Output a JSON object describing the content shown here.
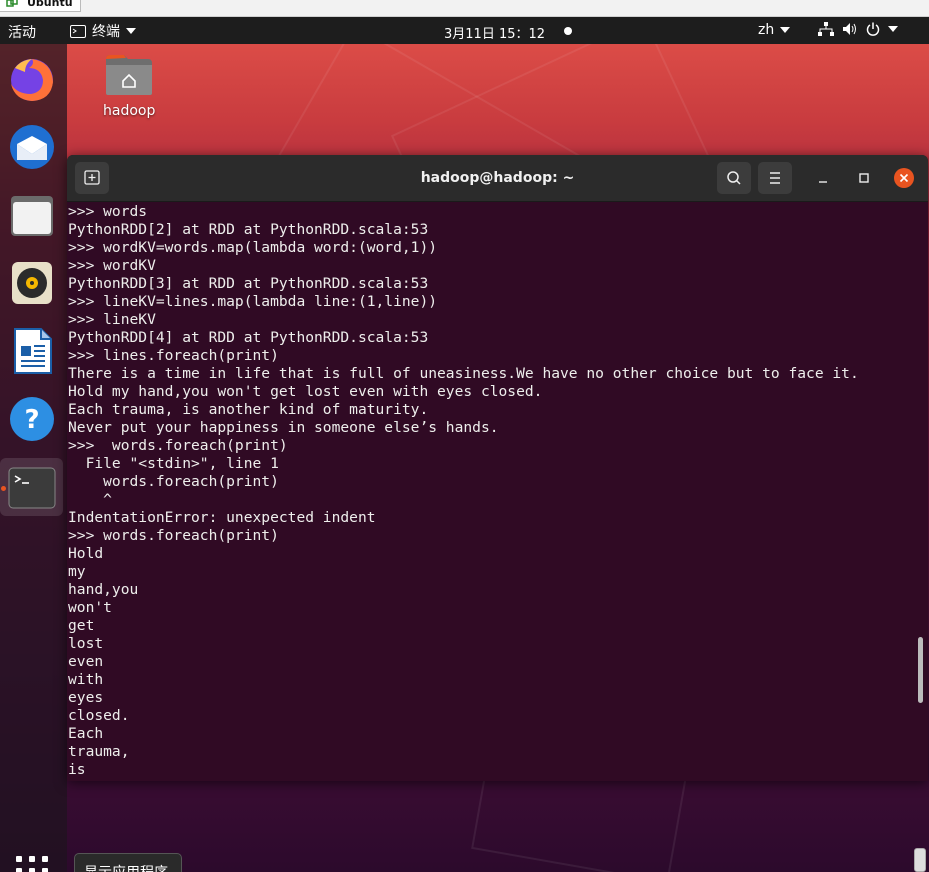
{
  "vm_tab": {
    "label": "Ubuntu"
  },
  "topbar": {
    "activities": "活动",
    "app_menu": "终端",
    "clock": "3月11日 15：12",
    "language": "zh"
  },
  "desktop": {
    "folder_label": "hadoop"
  },
  "dock": {
    "items": [
      "firefox",
      "thunderbird",
      "files",
      "rhythmbox",
      "libreoffice-writer",
      "help",
      "terminal"
    ],
    "show_apps_tooltip": "显示应用程序"
  },
  "terminal": {
    "title": "hadoop@hadoop: ~",
    "lines": [
      ">>> words",
      "PythonRDD[2] at RDD at PythonRDD.scala:53",
      ">>> wordKV=words.map(lambda word:(word,1))",
      ">>> wordKV",
      "PythonRDD[3] at RDD at PythonRDD.scala:53",
      ">>> lineKV=lines.map(lambda line:(1,line))",
      ">>> lineKV",
      "PythonRDD[4] at RDD at PythonRDD.scala:53",
      ">>> lines.foreach(print)",
      "There is a time in life that is full of uneasiness.We have no other choice but to face it.",
      "Hold my hand,you won't get lost even with eyes closed.",
      "Each trauma, is another kind of maturity.",
      "Never put your happiness in someone else’s hands.",
      ">>>  words.foreach(print)",
      "  File \"<stdin>\", line 1",
      "    words.foreach(print)",
      "    ^",
      "IndentationError: unexpected indent",
      ">>> words.foreach(print)",
      "Hold",
      "my",
      "hand,you",
      "won't",
      "get",
      "lost",
      "even",
      "with",
      "eyes",
      "closed.",
      "Each",
      "trauma,",
      "is"
    ]
  }
}
